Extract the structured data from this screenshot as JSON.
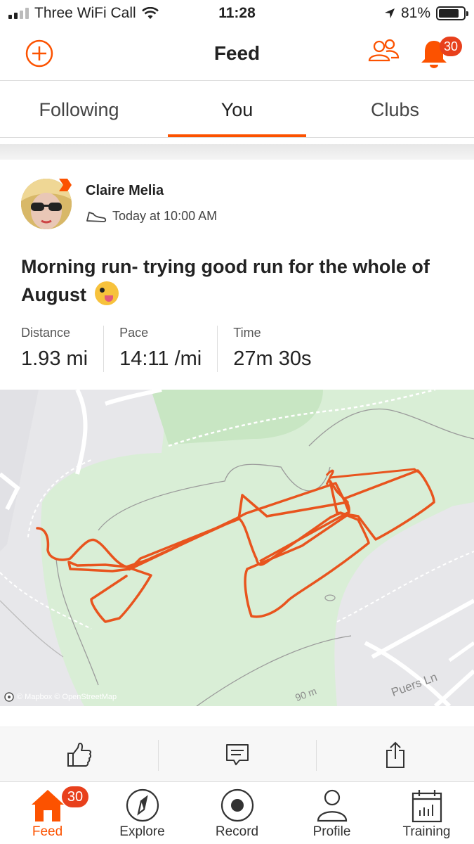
{
  "status_bar": {
    "carrier": "Three WiFi Call",
    "time": "11:28",
    "battery": "81%",
    "battery_level": 0.81
  },
  "header": {
    "title": "Feed",
    "notification_count": "30"
  },
  "tabs": [
    {
      "label": "Following",
      "active": false
    },
    {
      "label": "You",
      "active": true
    },
    {
      "label": "Clubs",
      "active": false
    }
  ],
  "activity": {
    "athlete_name": "Claire Melia",
    "timestamp": "Today at 10:00 AM",
    "title": "Morning run- trying good run for the whole of August",
    "stats": [
      {
        "label": "Distance",
        "value": "1.93 mi"
      },
      {
        "label": "Pace",
        "value": "14:11 /mi"
      },
      {
        "label": "Time",
        "value": "27m 30s"
      }
    ]
  },
  "map": {
    "attribution": "© Mapbox © OpenStreetMap",
    "street_label": "Puers Ln",
    "scale_label": "90 m"
  },
  "bottom_nav": {
    "items": [
      {
        "label": "Feed",
        "icon": "home-icon",
        "active": true
      },
      {
        "label": "Explore",
        "icon": "compass-icon",
        "active": false
      },
      {
        "label": "Record",
        "icon": "record-icon",
        "active": false
      },
      {
        "label": "Profile",
        "icon": "person-icon",
        "active": false
      },
      {
        "label": "Training",
        "icon": "calendar-chart-icon",
        "active": false
      }
    ],
    "feed_badge": "30"
  },
  "colors": {
    "accent": "#fc5200",
    "badge": "#e8401c",
    "route": "#e8541e",
    "park": "#d6ecd4"
  }
}
